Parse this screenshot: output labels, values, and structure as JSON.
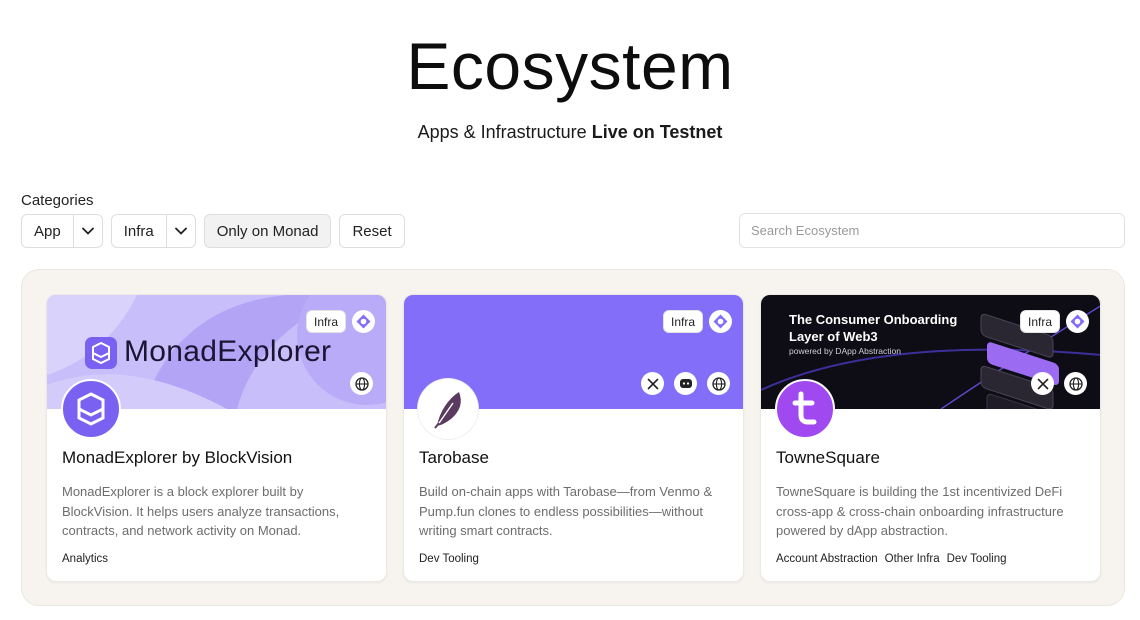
{
  "header": {
    "title": "Ecosystem",
    "subtitle_prefix": "Apps & Infrastructure",
    "subtitle_bold": "Live on Testnet"
  },
  "filters": {
    "label": "Categories",
    "app": "App",
    "infra": "Infra",
    "only_monad": "Only on Monad",
    "reset": "Reset"
  },
  "search": {
    "placeholder": "Search Ecosystem"
  },
  "colors": {
    "brand_purple": "#836ef9",
    "banner_lavender": "#c8befa",
    "banner_dark": "#0e0c15"
  },
  "cards": [
    {
      "name": "MonadExplorer by BlockVision",
      "badge": "Infra",
      "banner_text": "MonadExplorer",
      "description": "MonadExplorer is a block explorer built by BlockVision. It helps users analyze transactions, contracts, and network activity on Monad.",
      "tags": [
        "Analytics"
      ],
      "links": [
        "globe-icon"
      ]
    },
    {
      "name": "Tarobase",
      "badge": "Infra",
      "description": "Build on-chain apps with Tarobase—from Venmo & Pump.fun clones to endless possibilities—without writing smart contracts.",
      "tags": [
        "Dev Tooling"
      ],
      "links": [
        "x-icon",
        "discord-icon",
        "globe-icon"
      ]
    },
    {
      "name": "TowneSquare",
      "badge": "Infra",
      "banner_title": "The Consumer Onboarding Layer of Web3",
      "banner_sub": "powered by DApp Abstraction",
      "description": "TowneSquare is building the 1st incentivized DeFi cross-app & cross-chain onboarding infrastructure powered by dApp abstraction.",
      "tags": [
        "Account Abstraction",
        "Other Infra",
        "Dev Tooling"
      ],
      "links": [
        "x-icon",
        "globe-icon"
      ]
    }
  ]
}
